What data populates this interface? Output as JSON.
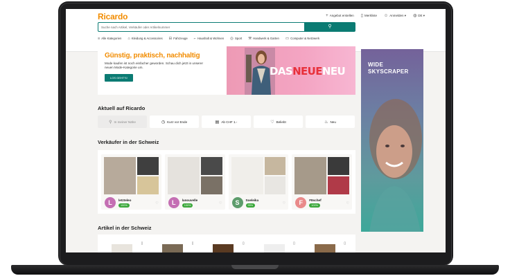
{
  "header": {
    "logo": "Ricardo",
    "links": [
      {
        "icon": "plus-icon",
        "glyph": "+",
        "label": "Angebot erstellen"
      },
      {
        "icon": "bookmark-icon",
        "glyph": "▯",
        "label": "Merkliste"
      },
      {
        "icon": "user-icon",
        "glyph": "☺",
        "label": "Anmelden"
      },
      {
        "icon": "globe-icon",
        "glyph": "◍",
        "label": "DE"
      }
    ]
  },
  "search": {
    "placeholder": "Suche nach Artikel, Verkäufer oder Artikelnummer",
    "button_glyph": "⚲"
  },
  "categories": [
    {
      "icon": "menu-icon",
      "glyph": "≡",
      "label": "Alle Kategorien"
    },
    {
      "icon": "shirt-icon",
      "glyph": "⌂",
      "label": "Kleidung & Accessoires"
    },
    {
      "icon": "car-icon",
      "glyph": "⊟",
      "label": "Fahrzeuge"
    },
    {
      "icon": "chair-icon",
      "glyph": "⌐",
      "label": "Haushalt & Wohnen"
    },
    {
      "icon": "ball-icon",
      "glyph": "◎",
      "label": "Sport"
    },
    {
      "icon": "tools-icon",
      "glyph": "⚒",
      "label": "Handwerk & Garten"
    },
    {
      "icon": "laptop-icon",
      "glyph": "▭",
      "label": "Computer & Netzwerk"
    }
  ],
  "banner": {
    "title": "Günstig, praktisch, nachhaltig",
    "subtitle": "Mode kaufen ist noch einfacher geworden. Schau dich jetzt in unserer neuen Mode-Kategorie um.",
    "button": "LOS GEHT'S!",
    "graphic_text_a": "DAS",
    "graphic_text_b": "NEUE",
    "graphic_text_c": "NEU"
  },
  "skyscraper": {
    "line1": "WIDE",
    "line2": "SKYSCRAPER"
  },
  "aktuell": {
    "title": "Aktuell auf Ricardo",
    "chips": [
      {
        "icon": "location-icon",
        "glyph": "⚲",
        "label": "In meiner Nähe"
      },
      {
        "icon": "clock-icon",
        "glyph": "◷",
        "label": "Kurz vor Ende"
      },
      {
        "icon": "price-icon",
        "glyph": "▤",
        "label": "Ab CHF 1.-"
      },
      {
        "icon": "heart-icon",
        "glyph": "♡",
        "label": "Beliebt"
      },
      {
        "icon": "new-icon",
        "glyph": "♨",
        "label": "Neu"
      }
    ]
  },
  "sellers_section": {
    "title": "Verkäufer in der Schweiz",
    "sellers": [
      {
        "initial": "L",
        "name": "letzteleo",
        "rating": "100%",
        "color": "#c46fb3"
      },
      {
        "initial": "L",
        "name": "lanouvelle",
        "rating": "100%",
        "color": "#c46fb3"
      },
      {
        "initial": "S",
        "name": "Soeleika",
        "rating": "99%",
        "color": "#5d9c6b"
      },
      {
        "initial": "F",
        "name": "F8schef",
        "rating": "100%",
        "color": "#e98a8a"
      }
    ]
  },
  "articles_section": {
    "title": "Artikel in der Schweiz"
  },
  "colors": {
    "brand_orange": "#f28c00",
    "brand_teal": "#0b7b73",
    "rating_green": "#3aa83a"
  }
}
